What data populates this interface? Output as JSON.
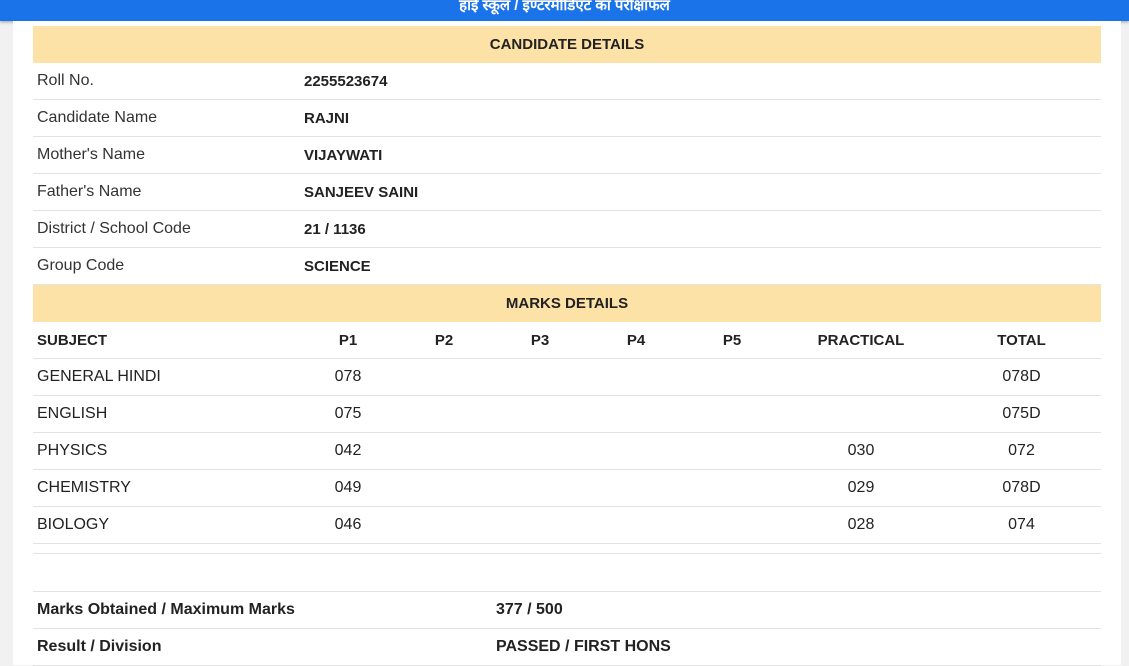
{
  "header": {
    "title": "हाई स्कूल / इण्टरमीडिएट का परीक्षाफल"
  },
  "candidate": {
    "heading": "CANDIDATE DETAILS",
    "rows": [
      {
        "label": "Roll No.",
        "value": "2255523674"
      },
      {
        "label": "Candidate Name",
        "value": "RAJNI"
      },
      {
        "label": "Mother's Name",
        "value": "VIJAYWATI"
      },
      {
        "label": "Father's Name",
        "value": "SANJEEV SAINI"
      },
      {
        "label": "District / School Code",
        "value": "21 / 1136"
      },
      {
        "label": "Group Code",
        "value": "SCIENCE"
      }
    ]
  },
  "marks": {
    "heading": "MARKS DETAILS",
    "columns": [
      "SUBJECT",
      "P1",
      "P2",
      "P3",
      "P4",
      "P5",
      "PRACTICAL",
      "TOTAL"
    ],
    "rows": [
      [
        "GENERAL HINDI",
        "078",
        "",
        "",
        "",
        "",
        "",
        "078D"
      ],
      [
        "ENGLISH",
        "075",
        "",
        "",
        "",
        "",
        "",
        "075D"
      ],
      [
        "PHYSICS",
        "042",
        "",
        "",
        "",
        "",
        "030",
        "072"
      ],
      [
        "CHEMISTRY",
        "049",
        "",
        "",
        "",
        "",
        "029",
        "078D"
      ],
      [
        "BIOLOGY",
        "046",
        "",
        "",
        "",
        "",
        "028",
        "074"
      ]
    ]
  },
  "summary": {
    "rows": [
      {
        "label": "Marks Obtained / Maximum Marks",
        "value": "377 / 500"
      },
      {
        "label": "Result / Division",
        "value": "PASSED / FIRST HONS"
      }
    ]
  }
}
